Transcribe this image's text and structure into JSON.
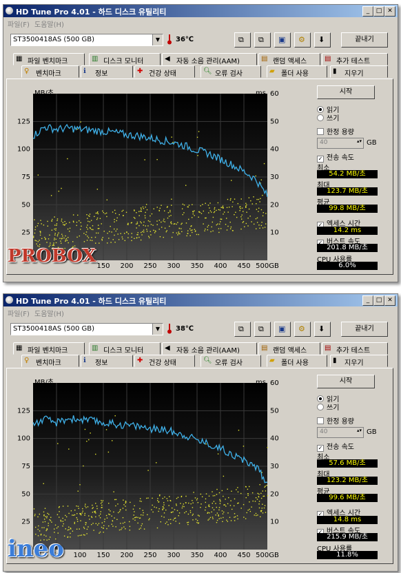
{
  "windows": [
    {
      "title": "HD Tune Pro 4.01 - 하드 디스크 유틸리티",
      "menu": [
        "파일(F)",
        "도움말(H)"
      ],
      "drive": "ST3500418AS (500 GB)",
      "temperature": "36℃",
      "exit_label": "끝내기",
      "tabs_row1": [
        "파일 벤치마크",
        "디스크 모니터",
        "자동 소음 관리(AAM)",
        "랜덤 액세스",
        "추가 테스트"
      ],
      "tabs_row2": [
        "벤치마크",
        "정보",
        "건강 상태",
        "오류 검사",
        "폴더 사용",
        "지우기"
      ],
      "start_label": "시작",
      "read_label": "읽기",
      "write_label": "쓰기",
      "short_stroke_label": "한정 용량",
      "short_stroke_value": "40",
      "gb_label": "GB",
      "transfer_rate_label": "전송 속도",
      "min_label": "최소",
      "min_value": "54.2 MB/초",
      "max_label": "최대",
      "max_value": "123.7 MB/초",
      "avg_label": "평균",
      "avg_value": "99.8 MB/초",
      "access_time_label": "엑세스 시간",
      "access_time_value": "14.2 ms",
      "burst_label": "버스트 속도",
      "burst_value": "201.8 MB/초",
      "cpu_label": "CPU 사용률",
      "cpu_value": "6.0%",
      "watermark": "PROBOX",
      "watermark_color": "#c0392b",
      "chart_data": {
        "type": "line",
        "ylabel_left": "MB/초",
        "ylabel_right": "ms",
        "x_ticks": [
          "150",
          "200",
          "250",
          "300",
          "350",
          "400",
          "450",
          "500GB"
        ],
        "y_left_ticks": [
          "125",
          "100",
          "75",
          "50",
          "25"
        ],
        "y_right_ticks": [
          "60",
          "50",
          "40",
          "30",
          "20",
          "10"
        ],
        "xlim": [
          0,
          500
        ],
        "ylim_left": [
          0,
          150
        ],
        "ylim_right": [
          0,
          60
        ],
        "series": [
          {
            "name": "transfer",
            "color": "#3fb0e8",
            "x": [
              0,
              25,
              50,
              75,
              100,
              125,
              150,
              175,
              200,
              225,
              250,
              275,
              300,
              325,
              350,
              375,
              400,
              425,
              450,
              475,
              500
            ],
            "y": [
              112,
              120,
              118,
              119,
              118,
              117,
              116,
              115,
              113,
              112,
              110,
              108,
              106,
              103,
              99,
              96,
              91,
              86,
              80,
              73,
              58
            ]
          },
          {
            "name": "access",
            "color": "#e6e630",
            "x": [
              0,
              100,
              200,
              300,
              400,
              500
            ],
            "y": [
              9,
              11,
              13,
              14.5,
              16,
              18
            ]
          }
        ]
      }
    },
    {
      "title": "HD Tune Pro 4.01 - 하드 디스크 유틸리티",
      "menu": [
        "파일(F)",
        "도움말(H)"
      ],
      "drive": "ST3500418AS (500 GB)",
      "temperature": "38℃",
      "exit_label": "끝내기",
      "tabs_row1": [
        "파일 벤치마크",
        "디스크 모니터",
        "자동 소음 관리(AAM)",
        "랜덤 액세스",
        "추가 테스트"
      ],
      "tabs_row2": [
        "벤치마크",
        "정보",
        "건강 상태",
        "오류 검사",
        "폴더 사용",
        "지우기"
      ],
      "start_label": "시작",
      "read_label": "읽기",
      "write_label": "쓰기",
      "short_stroke_label": "한정 용량",
      "short_stroke_value": "40",
      "gb_label": "GB",
      "transfer_rate_label": "전송 속도",
      "min_label": "최소",
      "min_value": "57.6 MB/초",
      "max_label": "최대",
      "max_value": "123.2 MB/초",
      "avg_label": "평균",
      "avg_value": "99.6 MB/초",
      "access_time_label": "엑세스 시간",
      "access_time_value": "14.8 ms",
      "burst_label": "버스트 속도",
      "burst_value": "215.9 MB/초",
      "cpu_label": "CPU 사용률",
      "cpu_value": "11.8%",
      "watermark": "ineo",
      "watermark_color": "#3b7dd8",
      "chart_data": {
        "type": "line",
        "ylabel_left": "MB/초",
        "ylabel_right": "ms",
        "x_ticks": [
          "50",
          "100",
          "150",
          "200",
          "250",
          "300",
          "350",
          "400",
          "450",
          "500GB"
        ],
        "y_left_ticks": [
          "125",
          "100",
          "75",
          "50",
          "25"
        ],
        "y_right_ticks": [
          "60",
          "50",
          "40",
          "30",
          "20",
          "10"
        ],
        "xlim": [
          0,
          500
        ],
        "ylim_left": [
          0,
          150
        ],
        "ylim_right": [
          0,
          60
        ],
        "series": [
          {
            "name": "transfer",
            "color": "#3fb0e8",
            "x": [
              0,
              25,
              50,
              75,
              100,
              125,
              150,
              175,
              200,
              225,
              250,
              275,
              300,
              325,
              350,
              375,
              400,
              425,
              450,
              475,
              500
            ],
            "y": [
              113,
              117,
              114,
              118,
              117,
              116,
              114,
              113,
              112,
              111,
              109,
              108,
              106,
              103,
              99,
              95,
              91,
              86,
              80,
              75,
              60
            ]
          },
          {
            "name": "access",
            "color": "#e6e630",
            "x": [
              0,
              100,
              200,
              300,
              400,
              500
            ],
            "y": [
              9,
              11,
              13,
              14.5,
              16,
              18
            ]
          }
        ]
      }
    }
  ]
}
